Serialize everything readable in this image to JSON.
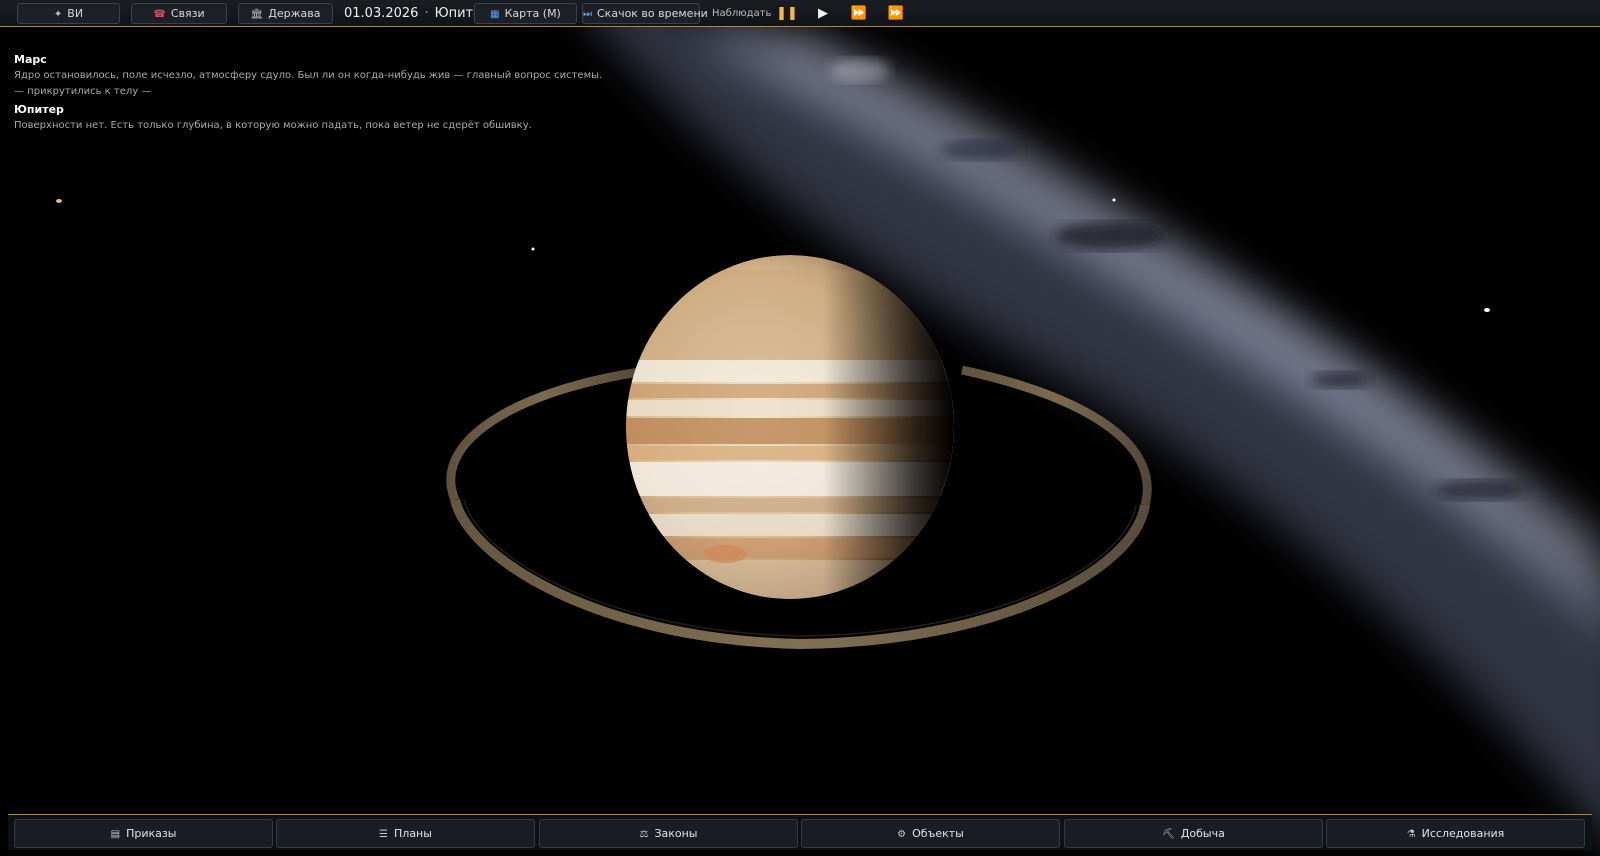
{
  "topbar": {
    "ai_button": {
      "icon": "sparkle-icon",
      "glyph": "✦",
      "label": "ВИ"
    },
    "contacts_button": {
      "icon": "contacts-icon",
      "glyph": "☎",
      "label": "Связи"
    },
    "state_button": {
      "icon": "government-icon",
      "glyph": "🏛",
      "label": "Держава"
    },
    "date": "01.03.2026",
    "separator": "·",
    "location": "Юпитер",
    "map_button": {
      "icon": "map-icon",
      "glyph": "▦",
      "label": "Карта (M)"
    },
    "timejump_button": {
      "icon": "skip-icon",
      "glyph": "⏭",
      "label": "Скачок во времени"
    },
    "observe_label": "Наблюдать",
    "controls": {
      "pause": "❚❚",
      "play": "▶",
      "fast": "⏩",
      "faster": "⏩"
    }
  },
  "info": {
    "mars_title": "Марс",
    "mars_text": "Ядро остановилось, поле исчезло, атмосферу сдуло. Был ли он когда-нибудь жив — главный вопрос системы.",
    "mars_note": "— прикрутились к телу —",
    "jupiter_title": "Юпитер",
    "jupiter_text": "Поверхности нет. Есть только глубина, в которую можно падать, пока ветер не сдерёт обшивку."
  },
  "bottombar": {
    "orders": {
      "icon": "orders-icon",
      "glyph": "▤",
      "label": "Приказы"
    },
    "plans": {
      "icon": "list-icon",
      "glyph": "☰",
      "label": "Планы"
    },
    "laws": {
      "icon": "scales-icon",
      "glyph": "⚖",
      "label": "Законы"
    },
    "objects": {
      "icon": "gear-icon",
      "glyph": "⚙",
      "label": "Объекты"
    },
    "mining": {
      "icon": "pickaxe-icon",
      "glyph": "⛏",
      "label": "Добыча"
    },
    "research": {
      "icon": "flask-icon",
      "glyph": "⚗",
      "label": "Исследования"
    }
  },
  "colors": {
    "accent": "#b08a3a",
    "pause_active": "#f2b84a",
    "background": "#000000"
  }
}
